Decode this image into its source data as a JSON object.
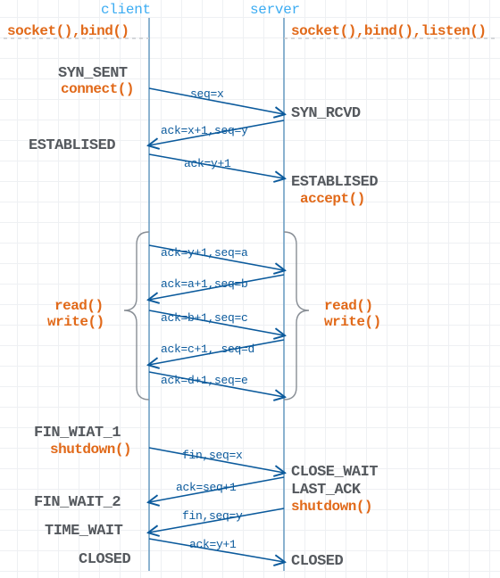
{
  "header": {
    "client": "client",
    "server": "server"
  },
  "client": {
    "setup": "socket(),bind()",
    "syn_sent": "SYN_SENT",
    "connect": "connect()",
    "established": "ESTABLISED",
    "rw_read": "read()",
    "rw_write": "write()",
    "fin_wait_1": "FIN_WIAT_1",
    "shutdown": "shutdown()",
    "fin_wait_2": "FIN_WAIT_2",
    "time_wait": "TIME_WAIT",
    "closed": "CLOSED"
  },
  "server": {
    "setup": "socket(),bind(),listen()",
    "syn_rcvd": "SYN_RCVD",
    "established": "ESTABLISED",
    "accept": "accept()",
    "rw_read": "read()",
    "rw_write": "write()",
    "close_wait": "CLOSE_WAIT",
    "last_ack": "LAST_ACK",
    "shutdown": "shutdown()",
    "closed": "CLOSED"
  },
  "messages": {
    "m1": "seq=x",
    "m2": "ack=x+1,seq=y",
    "m3": "ack=y+1",
    "d1": "ack=y+1,seq=a",
    "d2": "ack=a+1,seq=b",
    "d3": "ack=b+1,seq=c",
    "d4": "ack=c+1,  seq=d",
    "d5": "ack=d+1,seq=e",
    "f1": "fin,seq=x",
    "f2": "ack=seq+1",
    "f3": "fin,seq=y",
    "f4": "ack=y+1"
  },
  "layout": {
    "clientX": 167,
    "serverX": 318,
    "topY": 20,
    "botY": 640
  }
}
